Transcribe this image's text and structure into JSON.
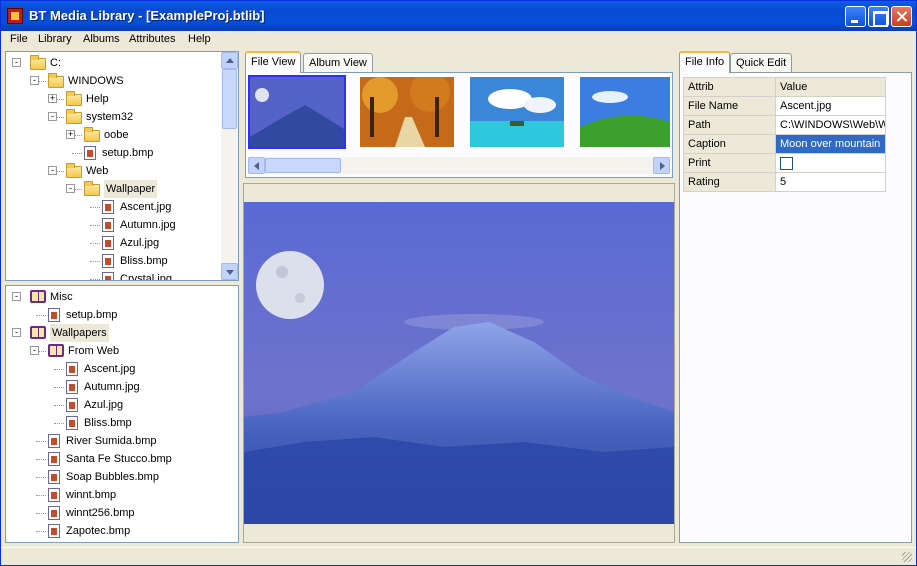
{
  "window": {
    "title": "BT Media Library - [ExampleProj.btlib]"
  },
  "menu": [
    "File",
    "Library",
    "Albums",
    "Attributes",
    "Help"
  ],
  "folder_tree": [
    {
      "label": "C:",
      "level": 0,
      "kind": "folder",
      "expander": "-"
    },
    {
      "label": "WINDOWS",
      "level": 1,
      "kind": "folder",
      "expander": "-"
    },
    {
      "label": "Help",
      "level": 2,
      "kind": "folder",
      "expander": "+"
    },
    {
      "label": "system32",
      "level": 2,
      "kind": "folder",
      "expander": "-"
    },
    {
      "label": "oobe",
      "level": 3,
      "kind": "folder",
      "expander": "+"
    },
    {
      "label": "setup.bmp",
      "level": 3,
      "kind": "file"
    },
    {
      "label": "Web",
      "level": 2,
      "kind": "folder",
      "expander": "-"
    },
    {
      "label": "Wallpaper",
      "level": 3,
      "kind": "folder",
      "expander": "-",
      "selected": true
    },
    {
      "label": "Ascent.jpg",
      "level": 4,
      "kind": "file"
    },
    {
      "label": "Autumn.jpg",
      "level": 4,
      "kind": "file"
    },
    {
      "label": "Azul.jpg",
      "level": 4,
      "kind": "file"
    },
    {
      "label": "Bliss.bmp",
      "level": 4,
      "kind": "file"
    },
    {
      "label": "Crystal.jpg",
      "level": 4,
      "kind": "file"
    }
  ],
  "album_tree": [
    {
      "label": "Misc",
      "level": 0,
      "kind": "album",
      "expander": "-"
    },
    {
      "label": "setup.bmp",
      "level": 1,
      "kind": "file"
    },
    {
      "label": "Wallpapers",
      "level": 0,
      "kind": "album",
      "expander": "-",
      "selected": true
    },
    {
      "label": "From Web",
      "level": 1,
      "kind": "album",
      "expander": "-"
    },
    {
      "label": "Ascent.jpg",
      "level": 2,
      "kind": "file"
    },
    {
      "label": "Autumn.jpg",
      "level": 2,
      "kind": "file"
    },
    {
      "label": "Azul.jpg",
      "level": 2,
      "kind": "file"
    },
    {
      "label": "Bliss.bmp",
      "level": 2,
      "kind": "file"
    },
    {
      "label": "River Sumida.bmp",
      "level": 1,
      "kind": "file"
    },
    {
      "label": "Santa Fe Stucco.bmp",
      "level": 1,
      "kind": "file"
    },
    {
      "label": "Soap Bubbles.bmp",
      "level": 1,
      "kind": "file"
    },
    {
      "label": "winnt.bmp",
      "level": 1,
      "kind": "file"
    },
    {
      "label": "winnt256.bmp",
      "level": 1,
      "kind": "file"
    },
    {
      "label": "Zapotec.bmp",
      "level": 1,
      "kind": "file"
    }
  ],
  "view_tabs": {
    "file_view": "File View",
    "album_view": "Album View"
  },
  "thumbnails": [
    "mountain-moon",
    "autumn-path",
    "tropical-sea",
    "green-hill"
  ],
  "info_tabs": {
    "file_info": "File Info",
    "quick_edit": "Quick Edit"
  },
  "properties": {
    "header": {
      "attrib": "Attrib",
      "value": "Value"
    },
    "rows": [
      {
        "attrib": "File Name",
        "value": "Ascent.jpg"
      },
      {
        "attrib": "Path",
        "value": "C:\\WINDOWS\\Web\\W"
      },
      {
        "attrib": "Caption",
        "value": "Moon over mountain"
      },
      {
        "attrib": "Print",
        "value": "",
        "checkbox": true
      },
      {
        "attrib": "Rating",
        "value": "5"
      }
    ]
  },
  "colors": {
    "selection": "#316ac5",
    "title_bar": "#0a5ee8",
    "tab_highlight": "#f3b93c"
  }
}
